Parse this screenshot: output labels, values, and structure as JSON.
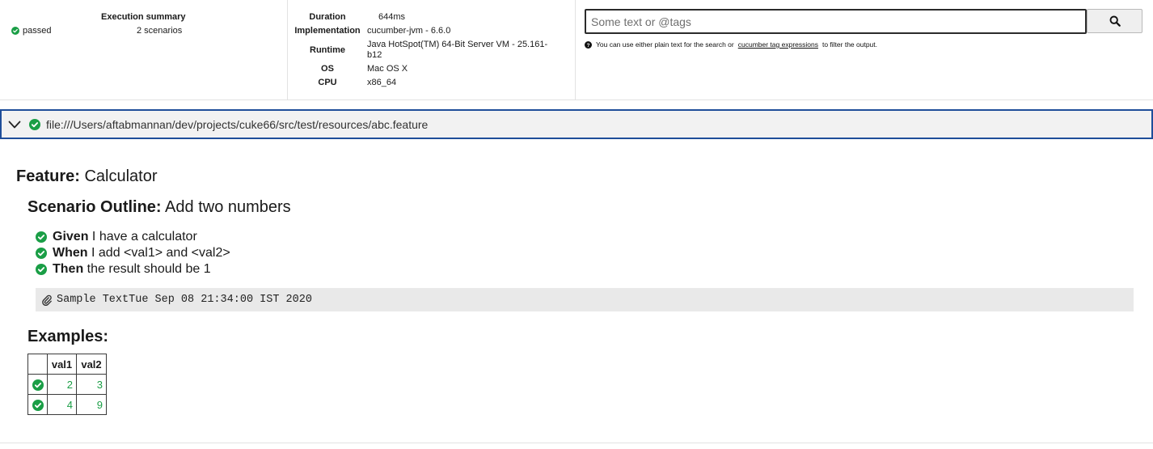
{
  "summary": {
    "title": "Execution summary",
    "status": "passed",
    "scenarios": "2 scenarios"
  },
  "environment": [
    {
      "key": "Duration",
      "value": "644ms"
    },
    {
      "key": "Implementation",
      "value": "cucumber-jvm - 6.6.0"
    },
    {
      "key": "Runtime",
      "value": "Java HotSpot(TM) 64-Bit Server VM - 25.161-b12"
    },
    {
      "key": "OS",
      "value": "Mac OS X"
    },
    {
      "key": "CPU",
      "value": "x86_64"
    }
  ],
  "search": {
    "placeholder": "Some text or @tags",
    "value": "",
    "hint_before": "You can use either plain text for the search or",
    "hint_link": "cucumber tag expressions",
    "hint_after": "to filter the output."
  },
  "feature": {
    "path": "file:///Users/aftabmannan/dev/projects/cuke66/src/test/resources/abc.feature",
    "keyword": "Feature:",
    "name": "Calculator",
    "scenario": {
      "keyword": "Scenario Outline:",
      "name": "Add two numbers",
      "steps": [
        {
          "keyword": "Given",
          "text": "I have a calculator"
        },
        {
          "keyword": "When",
          "text": "I add <val1> and <val2>"
        },
        {
          "keyword": "Then",
          "text": "the result should be 1"
        }
      ],
      "attachment": "Sample TextTue Sep 08 21:34:00 IST 2020",
      "examples": {
        "title": "Examples:",
        "headers": [
          "val1",
          "val2"
        ],
        "rows": [
          [
            "2",
            "3"
          ],
          [
            "4",
            "9"
          ]
        ]
      }
    }
  },
  "colors": {
    "pass": "#1a9e46",
    "accent_border": "#1f4e9a"
  },
  "icons": [
    "check-circle-icon",
    "help-circle-icon",
    "search-icon",
    "chevron-down-icon",
    "paperclip-icon"
  ]
}
